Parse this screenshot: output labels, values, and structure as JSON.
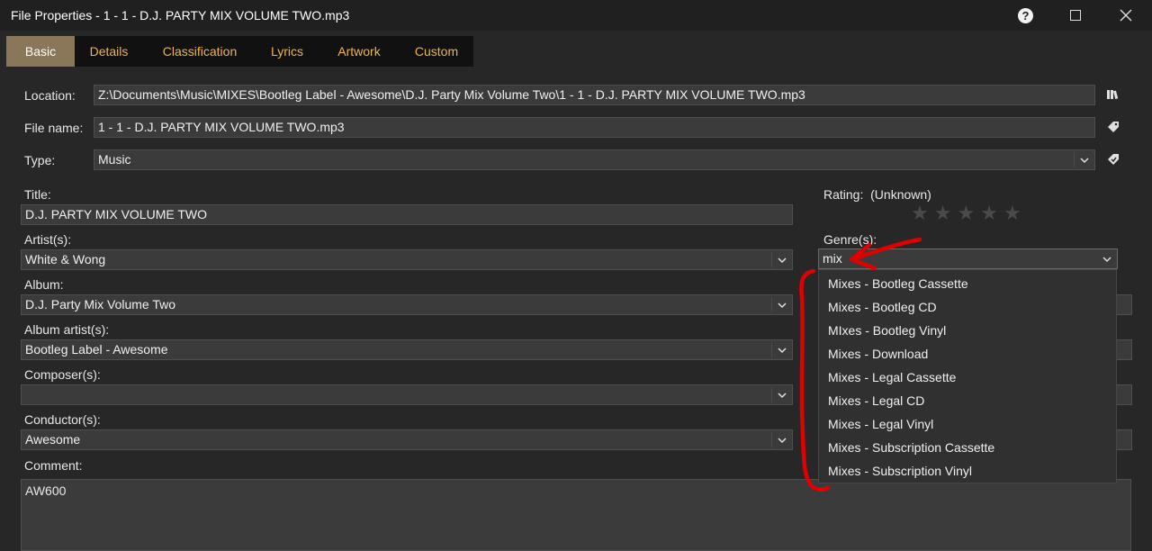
{
  "window": {
    "title": "File Properties - 1 - 1 - D.J. PARTY MIX VOLUME TWO.mp3"
  },
  "tabs": [
    {
      "label": "Basic",
      "active": true
    },
    {
      "label": "Details"
    },
    {
      "label": "Classification"
    },
    {
      "label": "Lyrics"
    },
    {
      "label": "Artwork"
    },
    {
      "label": "Custom"
    }
  ],
  "fields": {
    "location": {
      "label": "Location:",
      "value": "Z:\\Documents\\Music\\MIXES\\Bootleg Label - Awesome\\D.J. Party Mix Volume Two\\1 - 1 - D.J. PARTY MIX VOLUME TWO.mp3"
    },
    "filename": {
      "label": "File name:",
      "value": "1 - 1 - D.J. PARTY MIX VOLUME TWO.mp3"
    },
    "type": {
      "label": "Type:",
      "value": "Music"
    },
    "title": {
      "label": "Title:",
      "value": "D.J. PARTY MIX VOLUME TWO"
    },
    "artist": {
      "label": "Artist(s):",
      "value": "White & Wong"
    },
    "album": {
      "label": "Album:",
      "value": "D.J. Party Mix Volume Two"
    },
    "album_artist": {
      "label": "Album artist(s):",
      "value": "Bootleg Label - Awesome"
    },
    "composer": {
      "label": "Composer(s):",
      "value": ""
    },
    "conductor": {
      "label": "Conductor(s):",
      "value": "Awesome"
    },
    "comment": {
      "label": "Comment:",
      "value": "AW600"
    },
    "rating": {
      "label": "Rating:",
      "value": "(Unknown)",
      "stars": 5,
      "filled": 0
    },
    "genre": {
      "label": "Genre(s):",
      "value": "mix"
    }
  },
  "genre_suggestions": [
    "Mixes - Bootleg Cassette",
    "Mixes - Bootleg CD",
    "MIxes - Bootleg Vinyl",
    "Mixes - Download",
    "Mixes - Legal Cassette",
    "Mixes - Legal CD",
    "Mixes - Legal Vinyl",
    "Mixes - Subscription Cassette",
    "Mixes - Subscription Vinyl"
  ],
  "colors": {
    "background": "#272727",
    "field_bg": "#3b3b3b",
    "tab_text": "#efb54e",
    "tab_active_bg": "#8a7658",
    "annotation": "#e00000"
  },
  "icons": [
    "help-icon",
    "maximize-icon",
    "close-icon",
    "browse-location-icon",
    "tag-icon",
    "auto-tag-icon",
    "chevron-down-icon",
    "star-icon"
  ]
}
